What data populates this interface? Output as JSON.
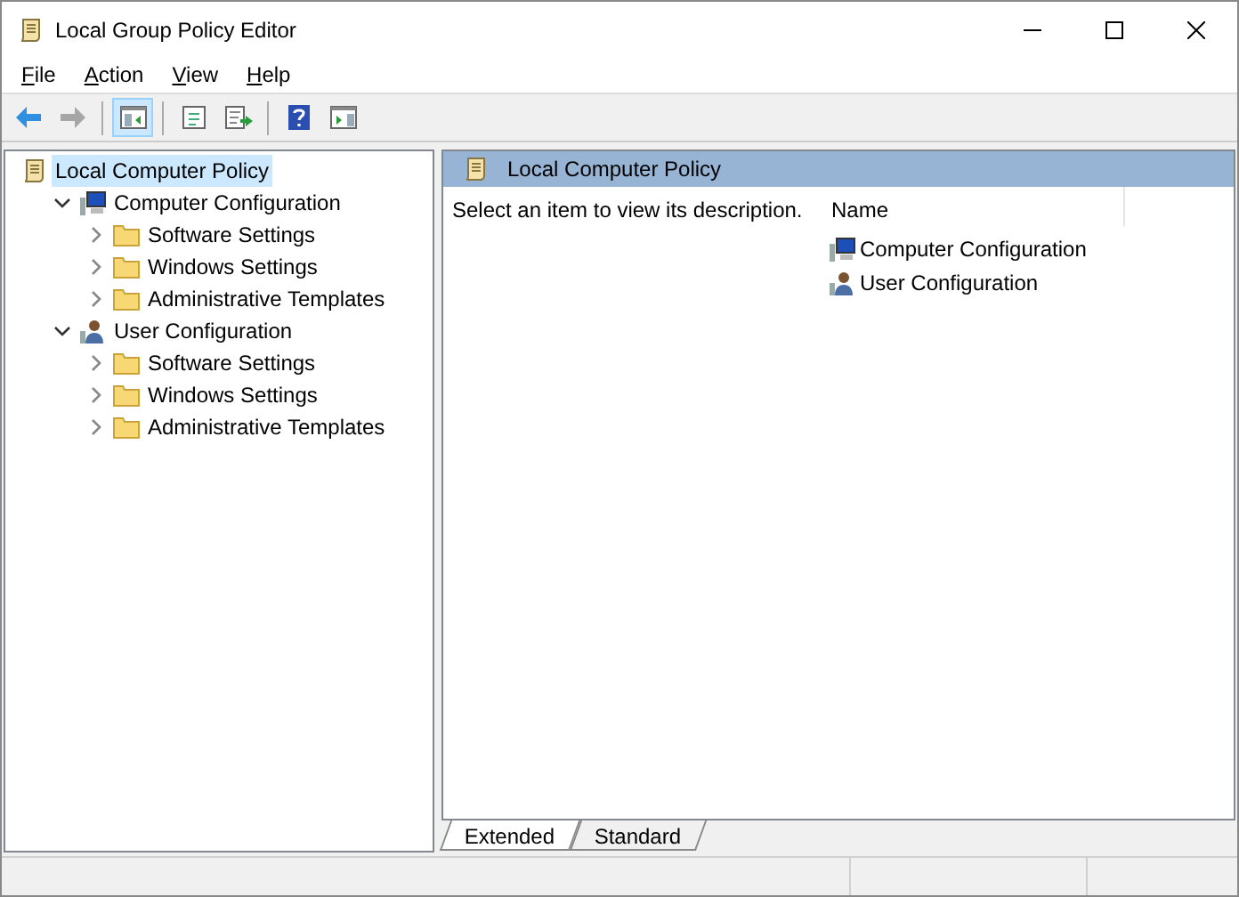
{
  "window": {
    "title": "Local Group Policy Editor"
  },
  "menu": [
    {
      "label": "File"
    },
    {
      "label": "Action"
    },
    {
      "label": "View"
    },
    {
      "label": "Help"
    }
  ],
  "toolbar": [
    {
      "kind": "back",
      "disabled": false,
      "pressed": false
    },
    {
      "kind": "forward",
      "disabled": true,
      "pressed": false
    },
    {
      "kind": "separator"
    },
    {
      "kind": "tree",
      "disabled": false,
      "pressed": true
    },
    {
      "kind": "separator"
    },
    {
      "kind": "properties",
      "disabled": false,
      "pressed": false
    },
    {
      "kind": "export",
      "disabled": false,
      "pressed": false
    },
    {
      "kind": "separator"
    },
    {
      "kind": "help",
      "disabled": false,
      "pressed": false
    },
    {
      "kind": "actionpane",
      "disabled": false,
      "pressed": false
    }
  ],
  "tree": {
    "label": "Local Computer Policy",
    "kind": "policy",
    "selected": true,
    "children": [
      {
        "label": "Computer Configuration",
        "kind": "computer",
        "selected": false,
        "expanded": true,
        "children": [
          {
            "label": "Software Settings",
            "kind": "folder",
            "selected": false,
            "expanded": false
          },
          {
            "label": "Windows Settings",
            "kind": "folder",
            "selected": false,
            "expanded": false
          },
          {
            "label": "Administrative Templates",
            "kind": "folder",
            "selected": false,
            "expanded": false
          }
        ]
      },
      {
        "label": "User Configuration",
        "kind": "user",
        "selected": false,
        "expanded": true,
        "children": [
          {
            "label": "Software Settings",
            "kind": "folder",
            "selected": false,
            "expanded": false
          },
          {
            "label": "Windows Settings",
            "kind": "folder",
            "selected": false,
            "expanded": false
          },
          {
            "label": "Administrative Templates",
            "kind": "folder",
            "selected": false,
            "expanded": false
          }
        ]
      }
    ]
  },
  "details": {
    "title": "Local Computer Policy",
    "description": "Select an item to view its description.",
    "columns": [
      "Name"
    ],
    "items": [
      {
        "label": "Computer Configuration",
        "kind": "computer"
      },
      {
        "label": "User Configuration",
        "kind": "user"
      }
    ]
  },
  "tabs": [
    {
      "label": "Extended",
      "selected": true
    },
    {
      "label": "Standard",
      "selected": false
    }
  ]
}
